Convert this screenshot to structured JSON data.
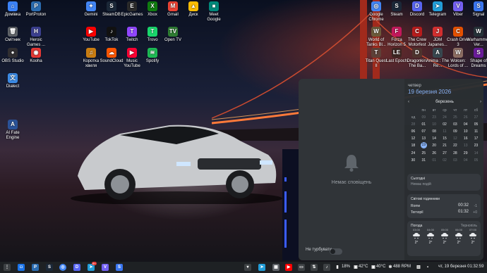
{
  "desktop_icons": [
    {
      "label": "Домівка",
      "color": "#3b82f6",
      "glyph": "⌂",
      "name": "home-folder-icon"
    },
    {
      "label": "PortProton",
      "color": "#2b6cb0",
      "glyph": "P",
      "name": "portproton-icon"
    },
    {
      "label": "Gemini",
      "color": "#4285f4",
      "glyph": "✦",
      "name": "gemini-icon"
    },
    {
      "label": "SteamDB",
      "color": "#1b2838",
      "glyph": "S",
      "name": "steamdb-icon"
    },
    {
      "label": "EpicGames",
      "color": "#2a2a2a",
      "glyph": "E",
      "name": "epic-games-icon"
    },
    {
      "label": "Xbox",
      "color": "#107c10",
      "glyph": "X",
      "name": "xbox-icon"
    },
    {
      "label": "Gmail",
      "color": "#ea4335",
      "glyph": "M",
      "name": "gmail-icon"
    },
    {
      "label": "Диск",
      "color": "#fbbc04",
      "glyph": "▲",
      "name": "google-drive-icon"
    },
    {
      "label": "Meet Google",
      "color": "#00897b",
      "glyph": "■",
      "name": "google-meet-icon"
    },
    {
      "label": "Смітник",
      "color": "#5f6368",
      "glyph": "🗑",
      "name": "trash-icon"
    },
    {
      "label": "Heroic Games ...",
      "color": "#3b3f8f",
      "glyph": "H",
      "name": "heroic-games-icon"
    },
    {
      "label": "YouTube",
      "color": "#ff0000",
      "glyph": "▶",
      "name": "youtube-icon"
    },
    {
      "label": "TokTok",
      "color": "#111111",
      "glyph": "♪",
      "name": "tiktok-icon"
    },
    {
      "label": "Twitch",
      "color": "#9146ff",
      "glyph": "T",
      "name": "twitch-icon"
    },
    {
      "label": "Trovo",
      "color": "#19d66b",
      "glyph": "T",
      "name": "trovo-icon"
    },
    {
      "label": "Open TV",
      "color": "#2e7d32",
      "glyph": "TV",
      "name": "open-tv-icon"
    },
    {
      "label": "OBS Studio",
      "color": "#302e31",
      "glyph": "●",
      "name": "obs-studio-icon"
    },
    {
      "label": "Kooha",
      "color": "#e53935",
      "glyph": "◉",
      "name": "kooha-icon"
    },
    {
      "label": "Коротка хвиля",
      "color": "#c97d12",
      "glyph": "♫",
      "name": "shortwave-icon"
    },
    {
      "label": "SoundCloud",
      "color": "#ff5500",
      "glyph": "☁",
      "name": "soundcloud-icon"
    },
    {
      "label": "Music YouTube",
      "color": "#ff0033",
      "glyph": "▶",
      "name": "youtube-music-icon"
    },
    {
      "label": "Spotify",
      "color": "#1db954",
      "glyph": "≋",
      "name": "spotify-icon"
    },
    {
      "label": "Dialect",
      "color": "#3c8ce7",
      "glyph": "文",
      "name": "dialect-icon"
    },
    {
      "label": "AI Fate Engine",
      "color": "#2a5298",
      "glyph": "A",
      "name": "ai-fate-engine-icon"
    },
    {
      "label": "Google Chrome",
      "color": "#4285f4",
      "glyph": "◎",
      "name": "google-chrome-icon"
    },
    {
      "label": "Steam",
      "color": "#1b2838",
      "glyph": "S",
      "name": "steam-icon"
    },
    {
      "label": "Discord",
      "color": "#5865f2",
      "glyph": "D",
      "name": "discord-icon"
    },
    {
      "label": "Telegram",
      "color": "#229ed9",
      "glyph": "➤",
      "name": "telegram-icon"
    },
    {
      "label": "Viber",
      "color": "#7360f2",
      "glyph": "V",
      "name": "viber-icon"
    },
    {
      "label": "Signal",
      "color": "#3a76f0",
      "glyph": "S",
      "name": "signal-icon"
    },
    {
      "label": "World of Tanks Bl...",
      "color": "#6b5a3a",
      "glyph": "W",
      "name": "world-of-tanks-icon"
    },
    {
      "label": "Forza Horizon 5",
      "color": "#c2185b",
      "glyph": "F",
      "name": "forza-horizon-icon"
    },
    {
      "label": "The Crew Motorfest",
      "color": "#b71c1c",
      "glyph": "C",
      "name": "the-crew-icon"
    },
    {
      "label": "JDM Japanes...",
      "color": "#d32f2f",
      "glyph": "J",
      "name": "jdm-icon"
    },
    {
      "label": "Crash Drive 3",
      "color": "#e65100",
      "glyph": "C",
      "name": "crash-drive-icon"
    },
    {
      "label": "Warhammer: Ver...",
      "color": "#263238",
      "glyph": "W",
      "name": "warhammer-icon"
    },
    {
      "label": "Titan Quest II",
      "color": "#5d4037",
      "glyph": "T",
      "name": "titan-quest-icon"
    },
    {
      "label": "Last Epoch",
      "color": "#3e2723",
      "glyph": "LE",
      "name": "last-epoch-icon"
    },
    {
      "label": "Dragonkin: The Ba...",
      "color": "#4e342e",
      "glyph": "D",
      "name": "dragonkin-icon"
    },
    {
      "label": "Anima : The Re...",
      "color": "#37474f",
      "glyph": "A",
      "name": "anima-icon"
    },
    {
      "label": "Wolcen: Lords of ...",
      "color": "#8d6e63",
      "glyph": "W",
      "name": "wolcen-icon"
    },
    {
      "label": "Shape of Dreams",
      "color": "#6a1b9a",
      "glyph": "S",
      "name": "shape-of-dreams-icon"
    }
  ],
  "notifications": {
    "empty_text": "Немає сповіщень",
    "dnd_label": "Не турбувати"
  },
  "calendar": {
    "weekday": "четвер",
    "full_date": "19 березня 2026",
    "month": "березень",
    "day_names": [
      "",
      "пн",
      "вт",
      "ср",
      "чт",
      "пт",
      "сб",
      "нд"
    ],
    "weeks": [
      [
        "09",
        "23",
        "24",
        "25",
        "26",
        "27",
        "28",
        "01"
      ],
      [
        "10",
        "02",
        "03",
        "04",
        "05",
        "06",
        "07",
        "08"
      ],
      [
        "11",
        "09",
        "10",
        "11",
        "12",
        "13",
        "14",
        "15"
      ],
      [
        "12",
        "16",
        "17",
        "18",
        "19",
        "20",
        "21",
        "22"
      ],
      [
        "13",
        "23",
        "24",
        "25",
        "26",
        "27",
        "28",
        "29"
      ],
      [
        "14",
        "30",
        "31",
        "01",
        "02",
        "03",
        "04",
        "05"
      ]
    ],
    "today": "19"
  },
  "today_card": {
    "title": "Сьогодні",
    "sub": "Немає подій"
  },
  "world_clocks": {
    "title": "Світові годинники",
    "rows": [
      {
        "city": "Rome",
        "time": "00:32",
        "offset": "-1"
      },
      {
        "city": "Ternopil",
        "time": "01:32",
        "offset": "+0"
      }
    ]
  },
  "weather": {
    "title": "Погода",
    "location": "Тернопіль",
    "hours": [
      "03:00",
      "04:00",
      "05:00",
      "06:00",
      "07:00"
    ],
    "temps": [
      "2°",
      "2°",
      "2°",
      "2°",
      "2°"
    ]
  },
  "taskbar": {
    "badge": "9+",
    "battery": "18%",
    "cpu_temp": "42°C",
    "gpu_temp": "40°C",
    "ram": "488 RPM",
    "datetime": "чт, 19 березня  01:32:59"
  }
}
